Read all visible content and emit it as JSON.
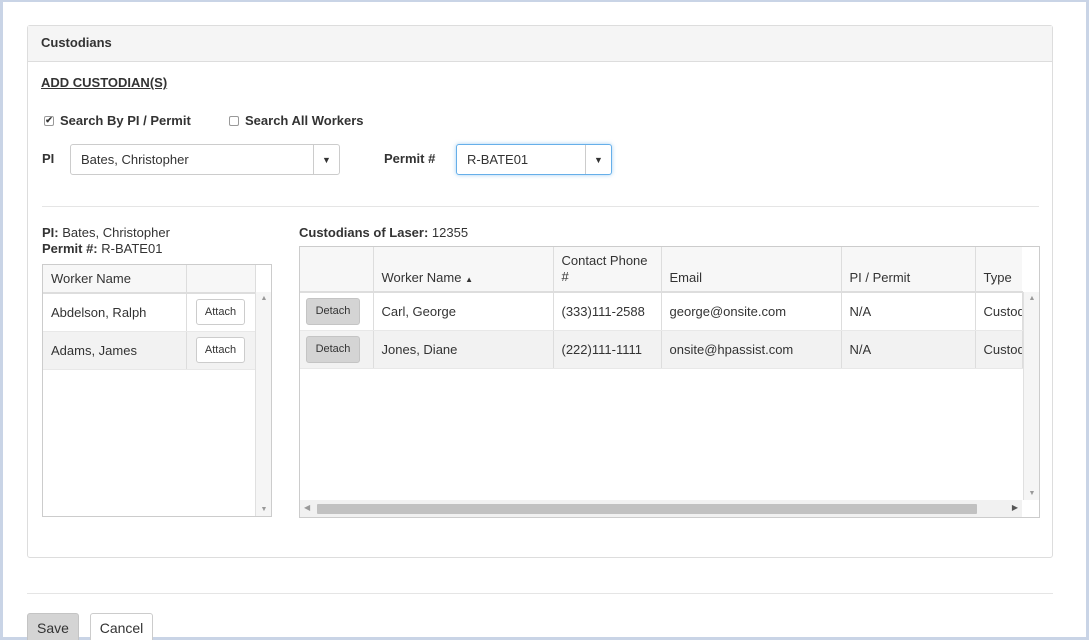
{
  "panel": {
    "title": "Custodians"
  },
  "add_link": "ADD CUSTODIAN(S)",
  "search": {
    "by_pi_label": "Search By PI / Permit",
    "by_pi_checked": true,
    "all_workers_label": "Search All Workers",
    "all_workers_checked": false
  },
  "pi_field": {
    "label": "PI",
    "value": "Bates, Christopher"
  },
  "permit_field": {
    "label": "Permit #",
    "value": "R-BATE01"
  },
  "left_info": {
    "pi_label": "PI:",
    "pi_value": "Bates, Christopher",
    "permit_label": "Permit #:",
    "permit_value": "R-BATE01"
  },
  "worker_grid": {
    "headers": [
      "Worker Name",
      ""
    ],
    "rows": [
      {
        "name": "Abdelson, Ralph",
        "action": "Attach"
      },
      {
        "name": "Adams, James",
        "action": "Attach"
      }
    ]
  },
  "custodian_grid": {
    "caption_label": "Custodians of Laser:",
    "caption_value": "12355",
    "headers": [
      "",
      "Worker Name",
      "Contact Phone #",
      "Email",
      "PI / Permit",
      "Type"
    ],
    "sort_indicator": "▲",
    "rows": [
      {
        "action": "Detach",
        "name": "Carl, George",
        "phone": "(333)111-2588",
        "email": "george@onsite.com",
        "pi_permit": "N/A",
        "type": "Custod"
      },
      {
        "action": "Detach",
        "name": "Jones, Diane",
        "phone": "(222)111-1111",
        "email": "onsite@hpassist.com",
        "pi_permit": "N/A",
        "type": "Custod"
      }
    ]
  },
  "footer": {
    "save_label": "Save",
    "cancel_label": "Cancel"
  },
  "icons": {
    "dropdown": "chevron-down-icon",
    "check": "check-icon"
  },
  "colors": {
    "panel_heading_bg": "#f5f5f5",
    "focus_border": "#66afe9",
    "detach_button_bg": "#d4d4d4"
  }
}
